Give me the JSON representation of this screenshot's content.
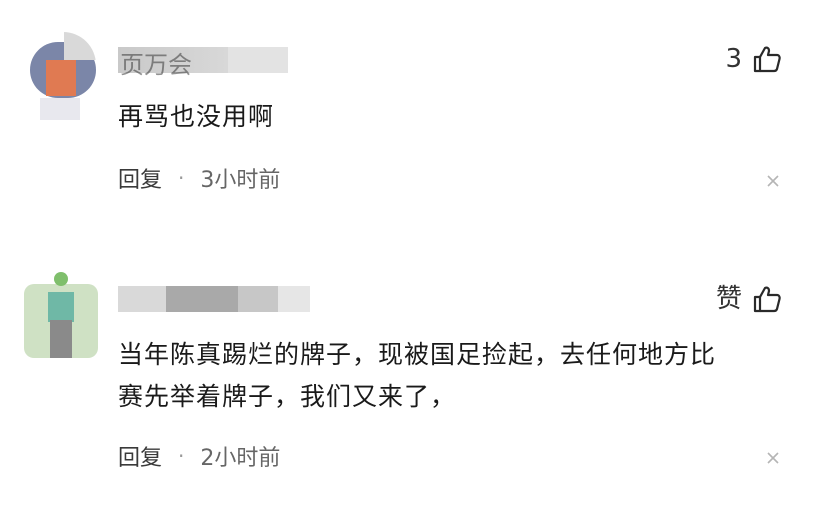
{
  "comments": [
    {
      "username_partial": "页万会",
      "like_count": "3",
      "text": "再骂也没用啊",
      "reply_label": "回复",
      "separator": "·",
      "time": "3小时前"
    },
    {
      "like_label": "赞",
      "text_line1": "当年陈真踢烂的牌子，现被国足捡起，去任何地方比",
      "text_line2": "赛先举着牌子，我们又来了，",
      "reply_label": "回复",
      "separator": "·",
      "time": "2小时前"
    }
  ],
  "colors": {
    "background": "#ffffff",
    "text": "#1a1a1a",
    "meta": "#666666"
  },
  "icons": [
    "thumbs-up-icon",
    "close-icon"
  ]
}
